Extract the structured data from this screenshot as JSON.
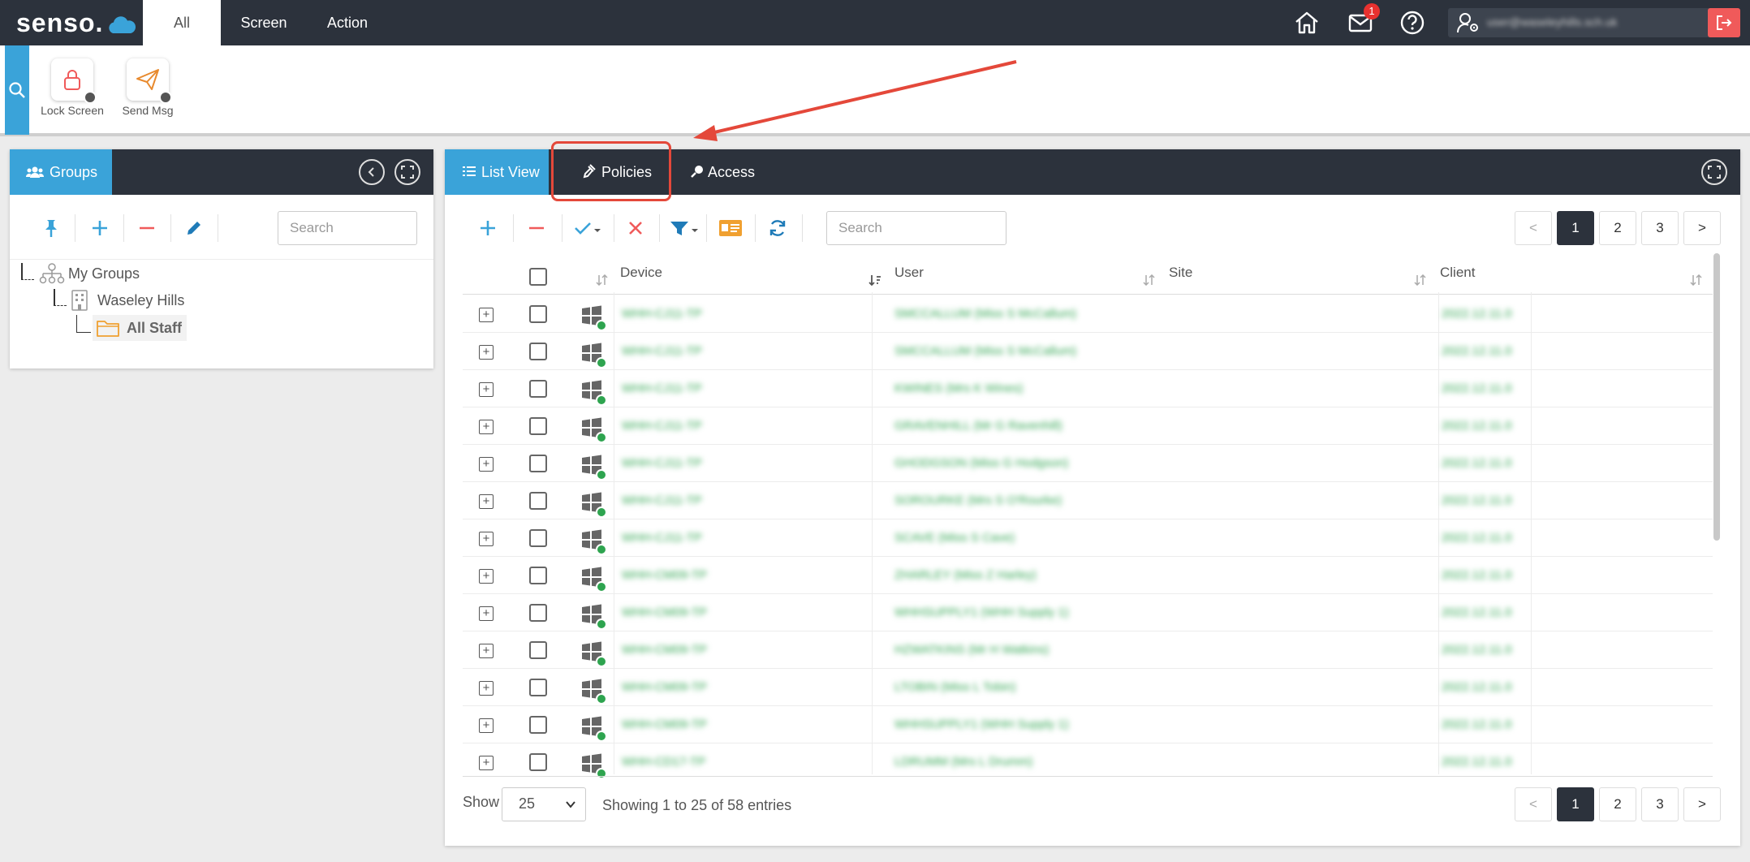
{
  "app": {
    "logo_text": "senso.",
    "nav_tabs": [
      "All",
      "Screen",
      "Action"
    ],
    "notifications_count": "1",
    "user_name": "user@waseleyhills.sch.uk"
  },
  "actions": [
    {
      "label": "Lock Screen",
      "icon": "lock-icon"
    },
    {
      "label": "Send Msg",
      "icon": "paper-plane-icon"
    }
  ],
  "groups_panel": {
    "tab_label": "Groups",
    "search_placeholder": "Search",
    "tree": {
      "root": "My Groups",
      "school": "Waseley Hills",
      "selected": "All Staff"
    }
  },
  "main_panel": {
    "tabs": [
      "List View",
      "Policies",
      "Access"
    ],
    "search_placeholder": "Search",
    "pagination": {
      "prev": "<",
      "pages": [
        "1",
        "2",
        "3"
      ],
      "next": ">",
      "current": "1"
    },
    "columns": [
      "Device",
      "User",
      "Site",
      "Client"
    ],
    "rows": [
      {
        "device": "WHH-CJ11-TP",
        "user": "SMCCALLUM (Miss S McCallum)",
        "site": "",
        "client": "2022.12.11.0"
      },
      {
        "device": "WHH-CJ11-TP",
        "user": "SMCCALLUM (Miss S McCallum)",
        "site": "",
        "client": "2022.12.11.0"
      },
      {
        "device": "WHH-CJ11-TP",
        "user": "KWINES (Mrs K Wines)",
        "site": "",
        "client": "2022.12.11.0"
      },
      {
        "device": "WHH-CJ11-TP",
        "user": "GRAVENHILL (Mr G Ravenhill)",
        "site": "",
        "client": "2022.12.11.0"
      },
      {
        "device": "WHH-CJ11-TP",
        "user": "GHODGSON (Miss G Hodgson)",
        "site": "",
        "client": "2022.12.11.0"
      },
      {
        "device": "WHH-CJ11-TP",
        "user": "SOROURKE (Mrs S O'Rourke)",
        "site": "",
        "client": "2022.12.11.0"
      },
      {
        "device": "WHH-CJ11-TP",
        "user": "SCAVE (Miss S Cave)",
        "site": "",
        "client": "2022.12.11.0"
      },
      {
        "device": "WHH-CM09-TP",
        "user": "ZHARLEY (Miss Z Harley)",
        "site": "",
        "client": "2022.12.11.0"
      },
      {
        "device": "WHH-CM09-TP",
        "user": "WHHSUPPLY1 (WHH Supply 1)",
        "site": "",
        "client": "2022.12.11.0"
      },
      {
        "device": "WHH-CM09-TP",
        "user": "HZWATKINS (Mr H Watkins)",
        "site": "",
        "client": "2022.12.11.0"
      },
      {
        "device": "WHH-CM09-TP",
        "user": "LTOBIN (Miss L Tobin)",
        "site": "",
        "client": "2022.12.11.0"
      },
      {
        "device": "WHH-CM09-TP",
        "user": "WHHSUPPLY1 (WHH Supply 1)",
        "site": "",
        "client": "2022.12.11.0"
      },
      {
        "device": "WHH-CD17-TP",
        "user": "LDRUMM (Mrs L Drumm)",
        "site": "",
        "client": "2022.12.11.0"
      }
    ],
    "footer": {
      "show_label": "Show",
      "page_size": "25",
      "entries_text": "Showing 1 to 25 of 58 entries"
    }
  },
  "colors": {
    "topbar": "#2c323c",
    "accent": "#3aa3d9",
    "status_green": "#2ea44f",
    "danger": "#e8312f",
    "annotation": "#e4483a"
  }
}
